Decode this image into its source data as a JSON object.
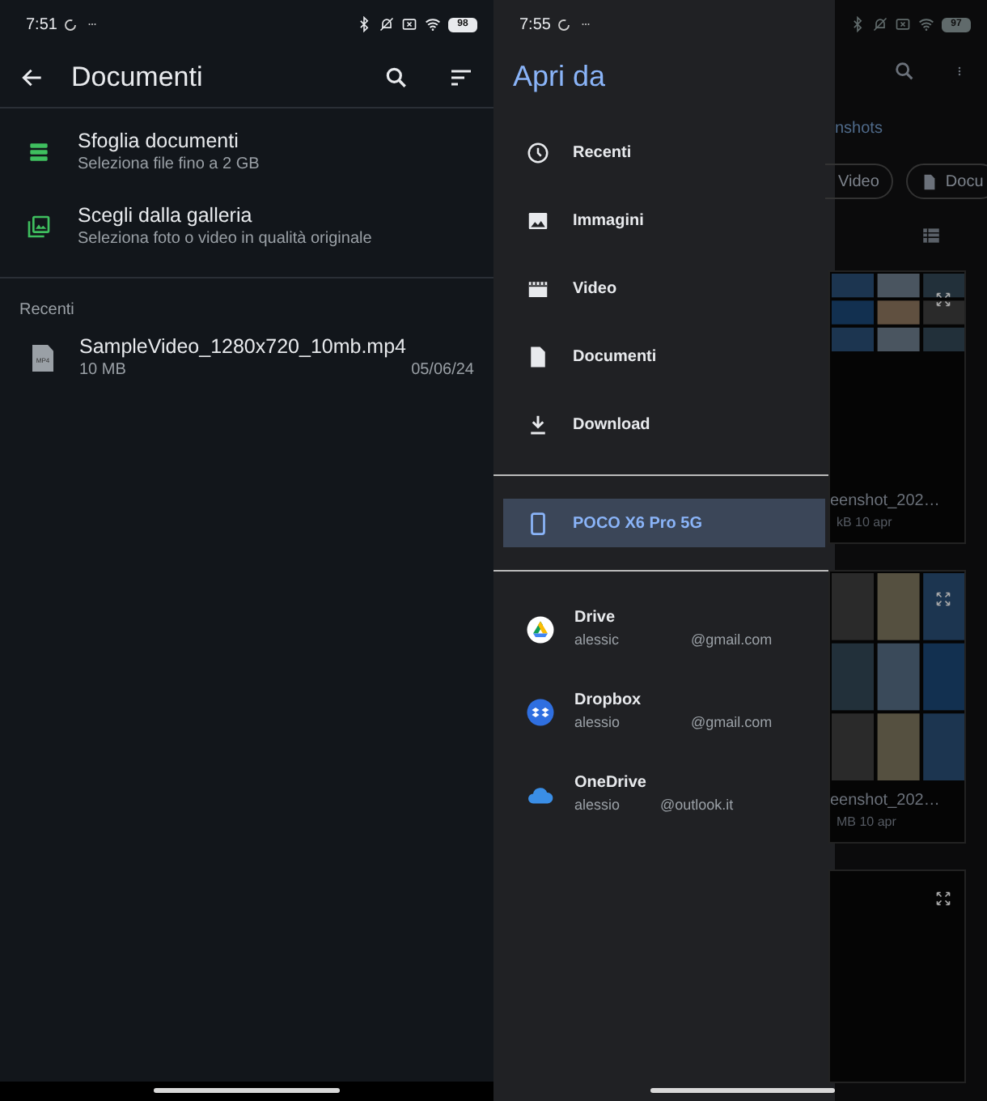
{
  "left_screen": {
    "status_bar": {
      "time": "7:51",
      "battery": "98"
    },
    "toolbar": {
      "title": "Documenti"
    },
    "options": [
      {
        "kind": "browse",
        "title": "Sfoglia documenti",
        "subtitle": "Seleziona file fino a 2 GB"
      },
      {
        "kind": "gallery",
        "title": "Scegli dalla galleria",
        "subtitle": "Seleziona foto o video in qualità originale"
      }
    ],
    "section_header": "Recenti",
    "files": [
      {
        "type_label": "MP4",
        "name": "SampleVideo_1280x720_10mb.mp4",
        "size": "10 MB",
        "date": "05/06/24"
      }
    ]
  },
  "right_screen": {
    "status_bar": {
      "time": "7:55",
      "battery": "97"
    },
    "drawer": {
      "title": "Apri da",
      "roots": [
        {
          "kind": "recent",
          "label": "Recenti",
          "selected": false
        },
        {
          "kind": "images",
          "label": "Immagini",
          "selected": false
        },
        {
          "kind": "video",
          "label": "Video",
          "selected": false
        },
        {
          "kind": "documents",
          "label": "Documenti",
          "selected": false
        },
        {
          "kind": "download",
          "label": "Download",
          "selected": false
        }
      ],
      "devices": [
        {
          "label": "POCO X6 Pro 5G",
          "selected": true
        }
      ],
      "accounts": [
        {
          "kind": "drive",
          "name": "Drive",
          "account_start": "alessic",
          "account_end": "@gmail.com"
        },
        {
          "kind": "dropbox",
          "name": "Dropbox",
          "account_start": "alessio",
          "account_end": "@gmail.com"
        },
        {
          "kind": "onedrive",
          "name": "OneDrive",
          "account_start": "alessio",
          "account_end": "@outlook.it"
        }
      ]
    },
    "background_app": {
      "tab": "nshots",
      "chips": [
        {
          "kind": "video",
          "label": "Video"
        },
        {
          "kind": "document",
          "label": "Docu"
        }
      ],
      "cards": [
        {
          "kind": "photos",
          "caption": "eenshot_202…",
          "meta": "kB 10 apr"
        },
        {
          "kind": "photos",
          "caption": "eenshot_202…",
          "meta": "MB 10 apr"
        },
        {
          "kind": "empty"
        }
      ]
    }
  }
}
